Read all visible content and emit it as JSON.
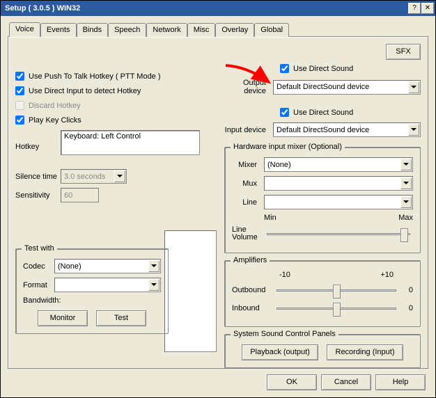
{
  "window": {
    "title": "Setup ( 3.0.5 ) WIN32"
  },
  "tabs": [
    "Voice",
    "Events",
    "Binds",
    "Speech",
    "Network",
    "Misc",
    "Overlay",
    "Global"
  ],
  "active_tab": "Voice",
  "left": {
    "ptt_label": "Use Push To Talk Hotkey ( PTT Mode )",
    "ptt_checked": true,
    "directinput_label": "Use Direct Input to detect Hotkey",
    "directinput_checked": true,
    "discard_label": "Discard Hotkey",
    "discard_checked": false,
    "playclicks_label": "Play Key Clicks",
    "playclicks_checked": true,
    "hotkey_label": "Hotkey",
    "hotkey_value": "Keyboard: Left Control",
    "silence_label": "Silence time",
    "silence_value": "3.0 seconds",
    "sensitivity_label": "Sensitivity",
    "sensitivity_value": "60",
    "testwith": {
      "legend": "Test with",
      "codec_label": "Codec",
      "codec_value": "(None)",
      "format_label": "Format",
      "format_value": "",
      "bandwidth_label": "Bandwidth:",
      "monitor": "Monitor",
      "test": "Test"
    }
  },
  "right": {
    "sfx": "SFX",
    "use_ds_out_label": "Use Direct Sound",
    "use_ds_out_checked": true,
    "output_label": "Output device",
    "output_value": "Default DirectSound device",
    "use_ds_in_label": "Use Direct Sound",
    "use_ds_in_checked": true,
    "input_label": "Input device",
    "input_value": "Default DirectSound device",
    "mixer": {
      "legend": "Hardware input mixer (Optional)",
      "mixer_label": "Mixer",
      "mixer_value": "(None)",
      "mux_label": "Mux",
      "mux_value": "",
      "line_label": "Line",
      "line_value": "",
      "min_label": "Min",
      "max_label": "Max",
      "linevol_label": "Line\nVolume"
    },
    "amp": {
      "legend": "Amplifiers",
      "neg10": "-10",
      "pos10": "+10",
      "outbound_label": "Outbound",
      "outbound_val": "0",
      "inbound_label": "Inbound",
      "inbound_val": "0"
    },
    "panels": {
      "legend": "System Sound Control Panels",
      "playback": "Playback (output)",
      "recording": "Recording (Input)"
    }
  },
  "dlg": {
    "ok": "OK",
    "cancel": "Cancel",
    "help": "Help"
  }
}
